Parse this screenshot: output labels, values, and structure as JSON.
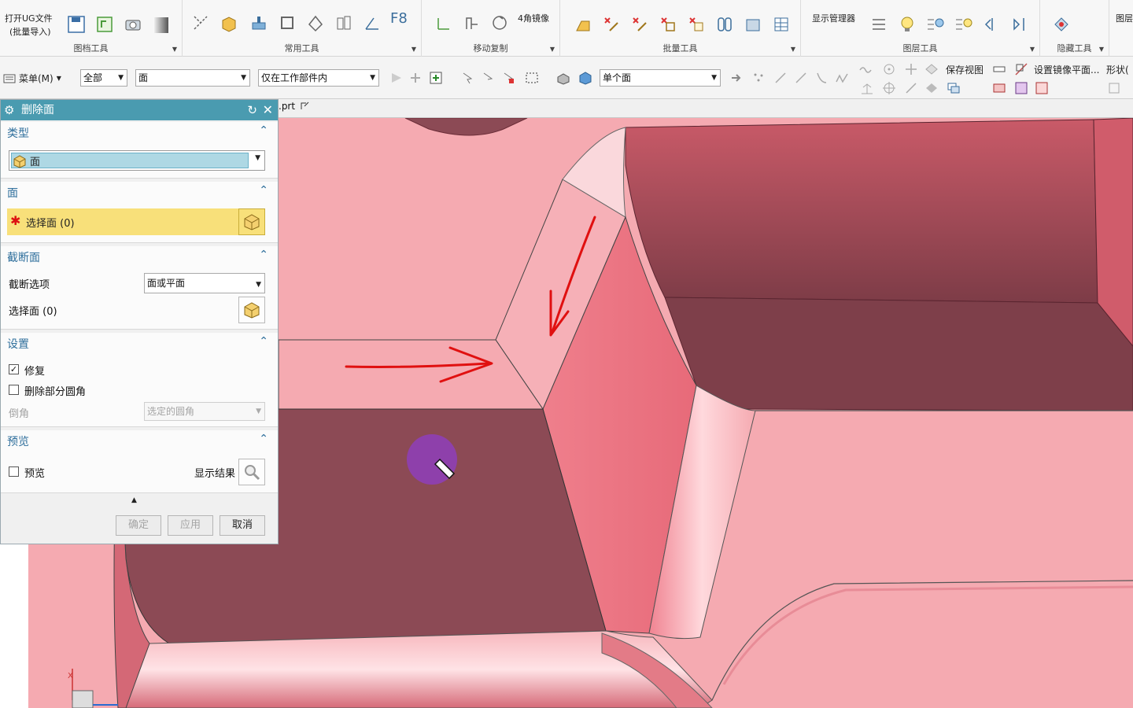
{
  "ribbon": {
    "groups": [
      {
        "label": "图档工具"
      },
      {
        "label": "常用工具"
      },
      {
        "label": "移动复制"
      },
      {
        "label": "批量工具"
      },
      {
        "label": "图层工具"
      },
      {
        "label": "隐藏工具"
      }
    ],
    "open_ug_label": "打开UG文件",
    "open_ug_sub": "(批量导入)",
    "f8_label": "F8",
    "mirror4_label": "4角镜像",
    "display_manager_label": "显示管理器",
    "layer_label": "图层"
  },
  "selbar": {
    "menu_label": "菜单(M)",
    "filter_all": "全部",
    "filter_face": "面",
    "filter_scope": "仅在工作部件内",
    "face_rule": "单个面",
    "save_view": "保存视图",
    "mirror_plane": "设置镜像平面...",
    "shape": "形状("
  },
  "tab": {
    "filename": ".prt"
  },
  "dialog": {
    "title": "删除面",
    "type_section": "类型",
    "type_value": "面",
    "face_section": "面",
    "select_face": "选择面 (0)",
    "cut_section": "截断面",
    "cut_option_label": "截断选项",
    "cut_option_value": "面或平面",
    "cut_select_face": "选择面 (0)",
    "settings_section": "设置",
    "repair_label": "修复",
    "repair_checked": true,
    "delete_partial_blend_label": "删除部分圆角",
    "delete_partial_blend_checked": false,
    "chamfer_label": "倒角",
    "chamfer_value": "选定的圆角",
    "preview_section": "预览",
    "preview_label": "预览",
    "preview_checked": false,
    "show_result_label": "显示结果",
    "ok_label": "确定",
    "apply_label": "应用",
    "cancel_label": "取消"
  },
  "colors": {
    "title_bar": "#4a9bb0",
    "face_light": "#f5aab1",
    "face_dark": "#8c4a55",
    "annotation_red": "#e01010",
    "cursor_highlight": "#8e3fb5",
    "selection_highlight": "#f8e07a"
  }
}
